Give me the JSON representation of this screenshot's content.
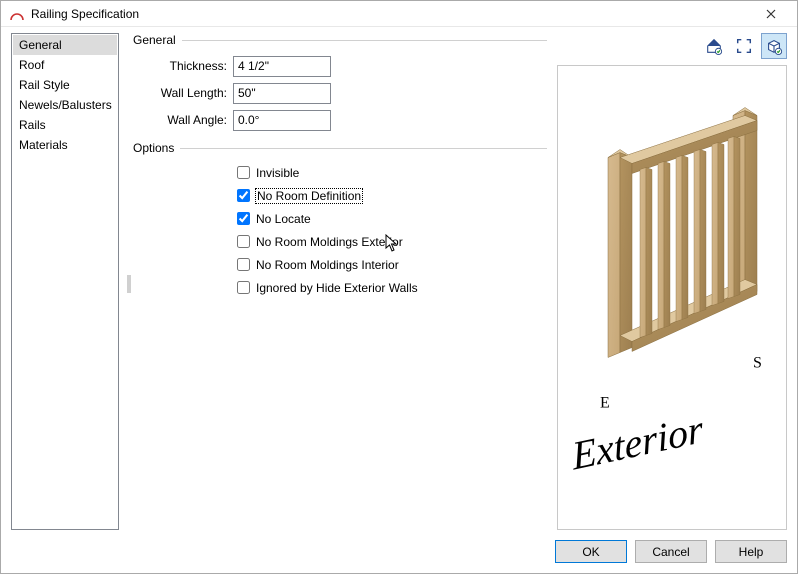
{
  "window": {
    "title": "Railing Specification"
  },
  "sidebar": {
    "items": [
      {
        "label": "General",
        "selected": true
      },
      {
        "label": "Roof"
      },
      {
        "label": "Rail Style"
      },
      {
        "label": "Newels/Balusters"
      },
      {
        "label": "Rails"
      },
      {
        "label": "Materials"
      }
    ]
  },
  "groups": {
    "general_label": "General",
    "options_label": "Options"
  },
  "fields": {
    "thickness": {
      "label": "Thickness:",
      "value": "4 1/2\""
    },
    "wall_length": {
      "label": "Wall Length:",
      "value": "50\""
    },
    "wall_angle": {
      "label": "Wall Angle:",
      "value": "0.0°"
    }
  },
  "options": {
    "invisible": {
      "label": "Invisible",
      "checked": false
    },
    "no_room_def": {
      "label": "No Room Definition",
      "checked": true,
      "focused": true
    },
    "no_locate": {
      "label": "No Locate",
      "checked": true
    },
    "no_moldings_ext": {
      "label": "No Room Moldings Exterior",
      "checked": false
    },
    "no_moldings_int": {
      "label": "No Room Moldings Interior",
      "checked": false
    },
    "ignored_hide_ext": {
      "label": "Ignored by Hide Exterior Walls",
      "checked": false
    }
  },
  "preview": {
    "tool_active": "cube",
    "label_e": "E",
    "label_s": "S",
    "label_exterior": "Exterior"
  },
  "buttons": {
    "ok": "OK",
    "cancel": "Cancel",
    "help": "Help"
  }
}
